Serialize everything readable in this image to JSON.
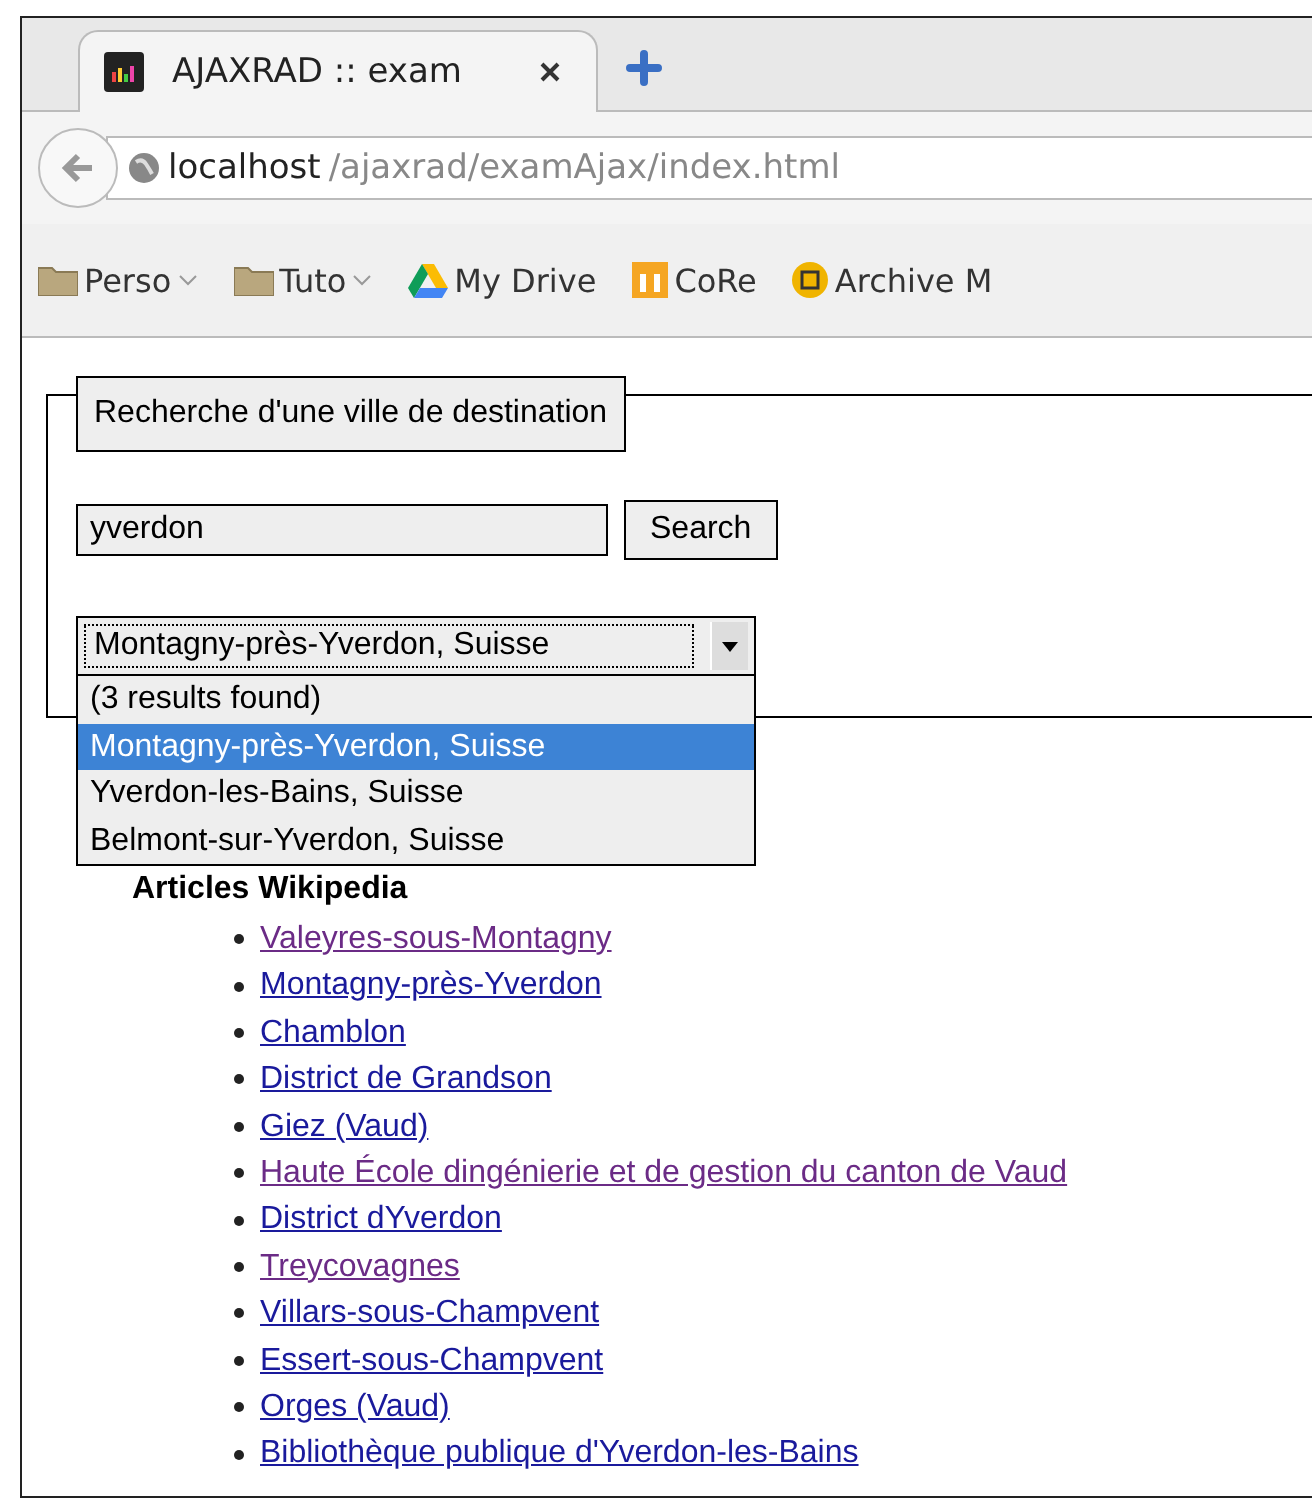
{
  "browser": {
    "tab": {
      "title": "AJAXRAD :: exam",
      "selected": true
    },
    "address": {
      "host": "localhost",
      "path": "/ajaxrad/examAjax/index.html"
    },
    "bookmarks": [
      {
        "kind": "folder",
        "label": "Perso"
      },
      {
        "kind": "folder",
        "label": "Tuto"
      },
      {
        "kind": "drive",
        "label": "My Drive"
      },
      {
        "kind": "core",
        "label": "CoRe"
      },
      {
        "kind": "archive",
        "label": "Archive M"
      }
    ]
  },
  "search_form": {
    "legend": "Recherche d'une ville de destination",
    "query": "yverdon",
    "button": "Search",
    "select": {
      "value": "Montagny-près-Yverdon, Suisse",
      "expanded": true,
      "options": [
        {
          "label": "(3 results found)",
          "selected": false
        },
        {
          "label": "Montagny-près-Yverdon, Suisse",
          "selected": true
        },
        {
          "label": "Yverdon-les-Bains, Suisse",
          "selected": false
        },
        {
          "label": "Belmont-sur-Yverdon, Suisse",
          "selected": false
        }
      ]
    }
  },
  "articles": {
    "heading": "Articles Wikipedia",
    "links": [
      {
        "label": "Valeyres-sous-Montagny",
        "visited": true
      },
      {
        "label": "Montagny-près-Yverdon",
        "visited": false
      },
      {
        "label": "Chamblon",
        "visited": false
      },
      {
        "label": "District de Grandson",
        "visited": false
      },
      {
        "label": "Giez (Vaud)",
        "visited": false
      },
      {
        "label": "Haute École dingénierie et de gestion du canton de Vaud",
        "visited": true
      },
      {
        "label": "District dYverdon",
        "visited": false
      },
      {
        "label": "Treycovagnes",
        "visited": true
      },
      {
        "label": "Villars-sous-Champvent",
        "visited": false
      },
      {
        "label": "Essert-sous-Champvent",
        "visited": false
      },
      {
        "label": "Orges (Vaud)",
        "visited": false
      },
      {
        "label": "Bibliothèque publique d'Yverdon-les-Bains",
        "visited": false
      }
    ]
  }
}
